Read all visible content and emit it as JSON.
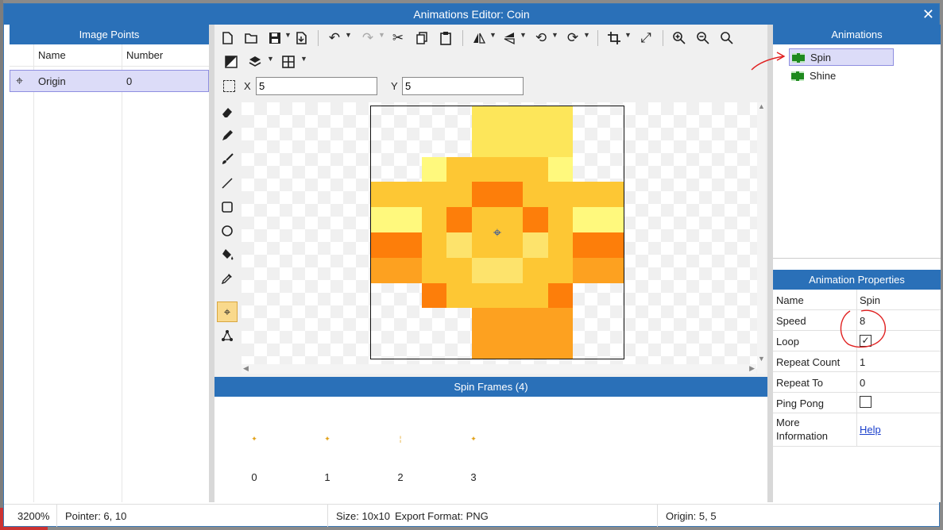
{
  "window": {
    "title": "Animations Editor: Coin",
    "close": "✕"
  },
  "image_points": {
    "header": "Image Points",
    "col_name": "Name",
    "col_number": "Number",
    "rows": [
      {
        "name": "Origin",
        "number": "0"
      }
    ]
  },
  "toolbar": {
    "icons": [
      "new-icon",
      "open-icon",
      "save-icon",
      "export-icon",
      "undo-icon",
      "redo-icon",
      "cut-icon",
      "copy-icon",
      "paste-icon",
      "flip-horizontal-icon",
      "flip-vertical-icon",
      "rotate-left-icon",
      "rotate-right-icon",
      "crop-icon",
      "resize-icon",
      "zoom-in-icon",
      "zoom-out-icon",
      "zoom-reset-icon",
      "transparency-icon",
      "layers-icon",
      "grid-icon"
    ]
  },
  "coords": {
    "x_label": "X",
    "x_value": "5",
    "y_label": "Y",
    "y_value": "5"
  },
  "tools": [
    "eraser-icon",
    "pencil-icon",
    "brush-icon",
    "line-icon",
    "rectangle-icon",
    "ellipse-icon",
    "fill-icon",
    "eyedropper-icon",
    "image-point-icon",
    "vertex-icon"
  ],
  "sprite": {
    "palette": {
      "t": "transparent",
      "a": "#fde65a",
      "b": "#fdc734",
      "c": "#fff97d",
      "d": "#fd7e0a",
      "e": "#fda120",
      "f": "#fde36c"
    },
    "rows": [
      "ttttaaaatt",
      "ttttaaaatt",
      "ttcbbbbctt",
      "bbbbddbbbb",
      "ccbdbbdbcc",
      "ddbfbbfbdd",
      "eebbffbbee",
      "ttdbbbbdtt",
      "tttteeeett",
      "tttteeeett"
    ]
  },
  "frames": {
    "header": "Spin Frames (4)",
    "items": [
      "0",
      "1",
      "2",
      "3"
    ]
  },
  "animations": {
    "header": "Animations",
    "items": [
      {
        "name": "Spin",
        "selected": true
      },
      {
        "name": "Shine",
        "selected": false
      }
    ]
  },
  "properties": {
    "header": "Animation Properties",
    "rows": [
      {
        "key": "Name",
        "value": "Spin"
      },
      {
        "key": "Speed",
        "value": "8"
      },
      {
        "key": "Loop",
        "check": "✓"
      },
      {
        "key": "Repeat Count",
        "value": "1"
      },
      {
        "key": "Repeat To",
        "value": "0"
      },
      {
        "key": "Ping Pong",
        "check": ""
      },
      {
        "key_line1": "More",
        "key_line2": "Information",
        "link": "Help"
      }
    ]
  },
  "status": {
    "zoom": "3200%",
    "pointer": "Pointer: 6, 10",
    "size": "Size: 10x10",
    "export": "Export Format: PNG",
    "origin": "Origin: 5, 5"
  },
  "colors": {
    "accent": "#2a70b8",
    "selection": "#dcdcf8",
    "active_tool": "#f9d98c",
    "annotation": "#e02020"
  }
}
